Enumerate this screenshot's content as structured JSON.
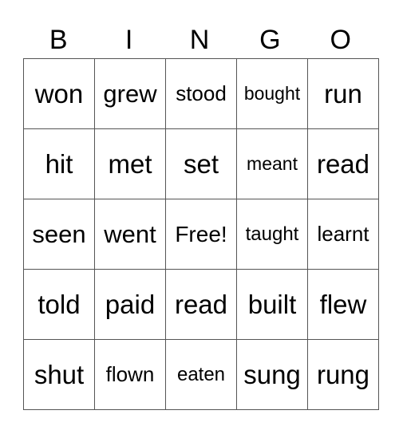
{
  "header": {
    "letters": [
      "B",
      "I",
      "N",
      "G",
      "O"
    ]
  },
  "card": {
    "rows": [
      [
        "won",
        "grew",
        "stood",
        "bought",
        "run"
      ],
      [
        "hit",
        "met",
        "set",
        "meant",
        "read"
      ],
      [
        "seen",
        "went",
        "Free!",
        "taught",
        "learnt"
      ],
      [
        "told",
        "paid",
        "read",
        "built",
        "flew"
      ],
      [
        "shut",
        "flown",
        "eaten",
        "sung",
        "rung"
      ]
    ]
  }
}
